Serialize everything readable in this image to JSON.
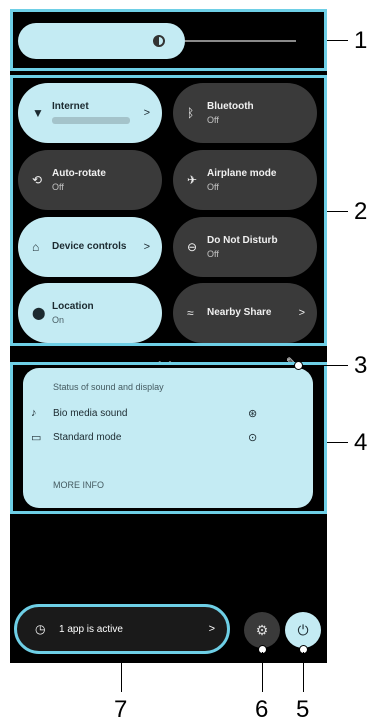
{
  "callouts": [
    "1",
    "2",
    "3",
    "4",
    "5",
    "6",
    "7"
  ],
  "brightness": {
    "level": 0.6
  },
  "tiles": [
    {
      "name": "Internet",
      "sub": "",
      "state": "on",
      "icon": "wifi-icon",
      "arrow": ">"
    },
    {
      "name": "Bluetooth",
      "sub": "Off",
      "state": "off",
      "icon": "bluetooth-icon"
    },
    {
      "name": "Auto-rotate",
      "sub": "Off",
      "state": "off",
      "icon": "rotate-icon"
    },
    {
      "name": "Airplane mode",
      "sub": "Off",
      "state": "off",
      "icon": "airplane-icon"
    },
    {
      "name": "Device controls",
      "sub": "",
      "state": "on",
      "icon": "home-icon",
      "arrow": ">"
    },
    {
      "name": "Do Not Disturb",
      "sub": "Off",
      "state": "off",
      "icon": "dnd-icon"
    },
    {
      "name": "Location",
      "sub": "On",
      "state": "on",
      "icon": "location-icon"
    },
    {
      "name": "Nearby Share",
      "sub": "",
      "state": "off",
      "icon": "nearby-share-icon",
      "arrow": ">"
    }
  ],
  "sound_display": {
    "title": "Status of sound and display",
    "rows": [
      {
        "label": "Bio media sound",
        "icon": "music-note-icon"
      },
      {
        "label": "Standard mode",
        "icon": "display-icon"
      }
    ],
    "more": "MORE INFO"
  },
  "footer": {
    "apps_label": "1 app is active",
    "apps_arrow": ">"
  }
}
